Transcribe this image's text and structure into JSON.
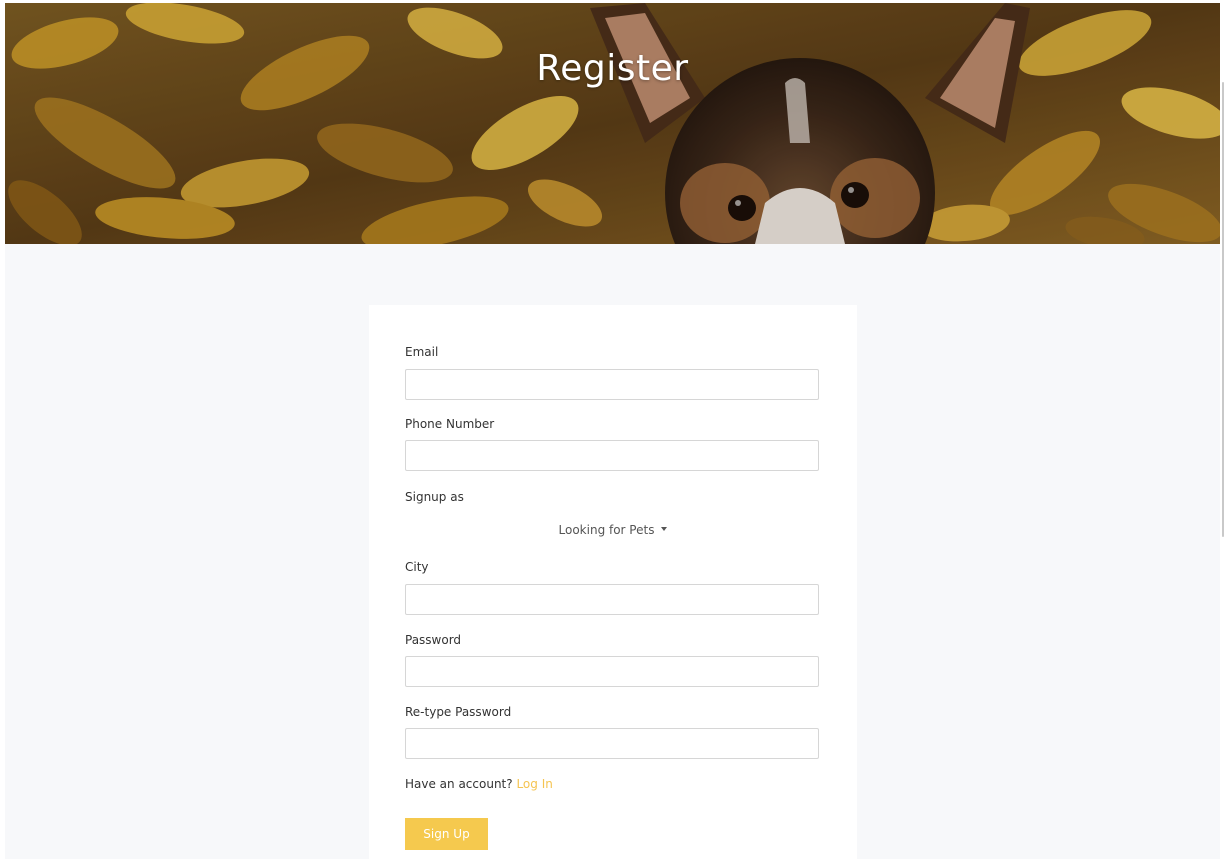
{
  "hero": {
    "title": "Register"
  },
  "form": {
    "email": {
      "label": "Email",
      "value": ""
    },
    "phone": {
      "label": "Phone Number",
      "value": ""
    },
    "signup_as": {
      "label": "Signup as",
      "selected": "Looking for Pets"
    },
    "city": {
      "label": "City",
      "value": ""
    },
    "password": {
      "label": "Password",
      "value": ""
    },
    "retype_password": {
      "label": "Re-type Password",
      "value": ""
    },
    "account_prompt": "Have an account?",
    "login_link": "Log In",
    "submit_label": "Sign Up"
  },
  "colors": {
    "accent": "#f5c94e",
    "link": "#f5c451",
    "section_bg": "#f7f8fa"
  }
}
